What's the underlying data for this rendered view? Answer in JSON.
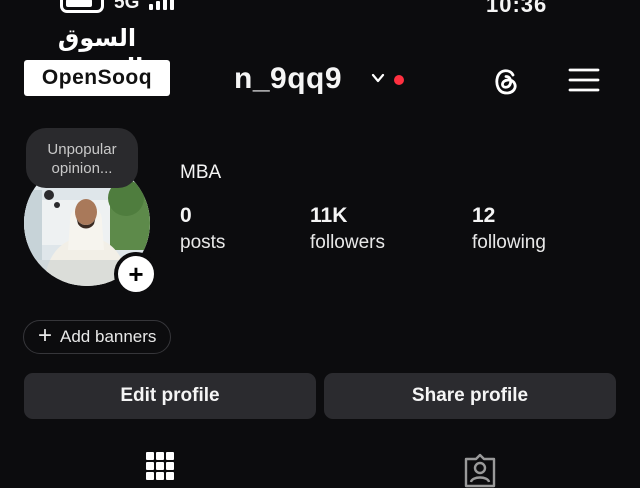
{
  "status_bar": {
    "network": "5G",
    "time": "10:36"
  },
  "watermark": {
    "arabic": "السوق المفتوح",
    "english": "OpenSooq"
  },
  "header": {
    "username": "n_9qq9",
    "icons": [
      "chevron-down-icon",
      "notification-dot",
      "threads-icon",
      "hamburger-menu-icon"
    ],
    "accent_color": "#ff3040"
  },
  "profile": {
    "note": "Unpopular opinion...",
    "name": "MBA",
    "stats": [
      {
        "value": "0",
        "label": "posts"
      },
      {
        "value": "11K",
        "label": "followers"
      },
      {
        "value": "12",
        "label": "following"
      }
    ]
  },
  "actions": {
    "add_banners": "Add banners",
    "edit_profile": "Edit profile",
    "share_profile": "Share profile"
  },
  "tabs": [
    "grid-icon",
    "tagged-icon"
  ]
}
